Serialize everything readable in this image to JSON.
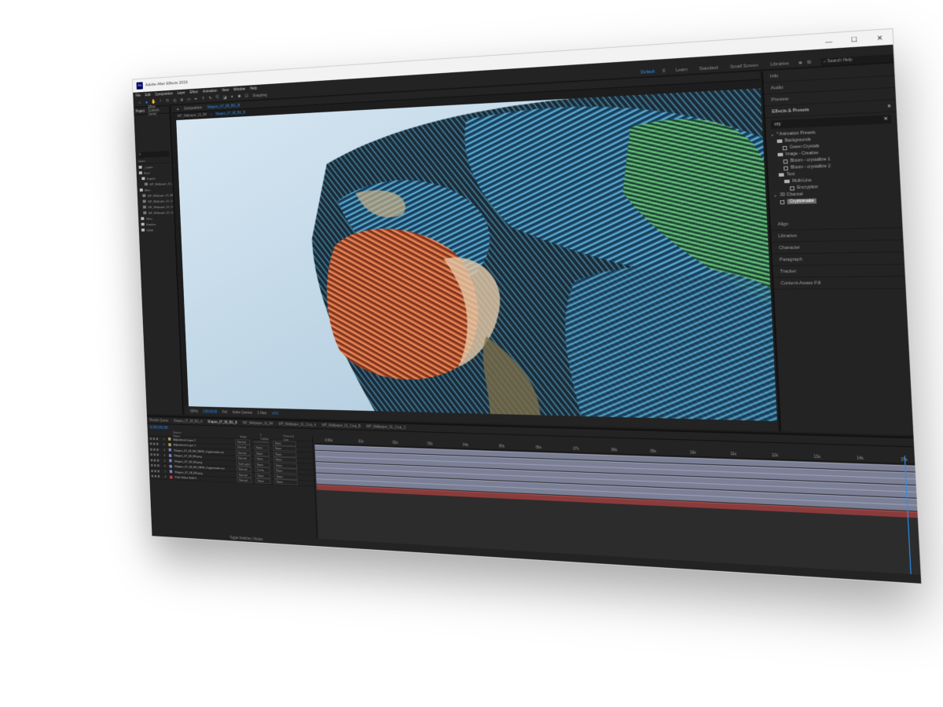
{
  "app": {
    "title": "Adobe After Effects 2019",
    "logo_text": "Ae",
    "window_controls": [
      "—",
      "☐",
      "✕"
    ]
  },
  "menu": [
    "File",
    "Edit",
    "Composition",
    "Layer",
    "Effect",
    "Animation",
    "View",
    "Window",
    "Help"
  ],
  "toolbar": {
    "snapping_label": "Snapping",
    "workspaces": [
      "Default",
      "Learn",
      "Standard",
      "Small Screen",
      "Libraries"
    ],
    "active_workspace": "Default",
    "more_label": "»",
    "search_help_placeholder": "Search Help"
  },
  "project_panel": {
    "tabs": [
      "Project",
      "Effect Controls (none)"
    ],
    "search_placeholder": "ρ.",
    "column_name": "Name",
    "items": [
      {
        "name": "_Layers",
        "type": "folder",
        "indent": 1
      },
      {
        "name": "Final",
        "type": "folder",
        "indent": 1
      },
      {
        "name": "Exports",
        "type": "folder",
        "indent": 2
      },
      {
        "name": "WP_Wallpaper_01_04.png",
        "type": "file",
        "indent": 3
      },
      {
        "name": "Main",
        "type": "folder",
        "indent": 1
      },
      {
        "name": "WP_Wallpaper_01_B4",
        "type": "comp",
        "indent": 2
      },
      {
        "name": "WP_Wallpaper_01_Crop_A",
        "type": "comp",
        "indent": 2
      },
      {
        "name": "WP_Wallpaper_01_Crop_B",
        "type": "comp",
        "indent": 2
      },
      {
        "name": "WP_Wallpaper_01_Crop_C",
        "type": "comp",
        "indent": 2
      },
      {
        "name": "Other",
        "type": "folder",
        "indent": 1
      },
      {
        "name": "Renders",
        "type": "folder",
        "indent": 1
      },
      {
        "name": "Solids",
        "type": "folder",
        "indent": 1
      }
    ]
  },
  "composition": {
    "tabs": [
      "Composition",
      "Shapes_07_08_BG_B"
    ],
    "breadcrumbs": [
      "WP_Wallpaper_01_B4",
      "Shapes_07_08_BG_B"
    ],
    "viewer_bar": [
      "(50%)",
      "0;00;00;00",
      "Full",
      "Active Camera",
      "1 View",
      "+0.0"
    ],
    "zoom_label": "(50%)"
  },
  "effects_panel": {
    "headers": [
      "Info",
      "Audio",
      "Preview",
      "Effects & Presets"
    ],
    "search_value": "cry",
    "menu_icon": "≡",
    "tree": [
      {
        "label": "* Animation Presets",
        "level": 0,
        "kind": "twirl"
      },
      {
        "label": "Backgrounds",
        "level": 1,
        "kind": "folder"
      },
      {
        "label": "Green Crystals",
        "level": 2,
        "kind": "effect"
      },
      {
        "label": "Image - Creative",
        "level": 1,
        "kind": "folder"
      },
      {
        "label": "Bloom - crystallize 1",
        "level": 2,
        "kind": "effect"
      },
      {
        "label": "Bloom - crystallize 2",
        "level": 2,
        "kind": "effect"
      },
      {
        "label": "Text",
        "level": 1,
        "kind": "folder"
      },
      {
        "label": "Multi-Line",
        "level": 2,
        "kind": "folder"
      },
      {
        "label": "Encryption",
        "level": 3,
        "kind": "effect"
      },
      {
        "label": "3D Channel",
        "level": 0,
        "kind": "twirl"
      },
      {
        "label": "Cryptomatte",
        "level": 1,
        "kind": "effect",
        "selected": true
      }
    ],
    "other_panels": [
      "Align",
      "Libraries",
      "Character",
      "Paragraph",
      "Tracker",
      "Content-Aware Fill"
    ]
  },
  "timeline": {
    "tabs": [
      "Render Queue",
      "Shapes_07_08_BG_A",
      "Shapes_07_08_BG_B",
      "WP_Wallpaper_01_B4",
      "WP_Wallpaper_01_Crop_A",
      "WP_Wallpaper_01_Crop_B",
      "WP_Wallpaper_01_Crop_C"
    ],
    "current_tab": "Shapes_07_08_BG_B",
    "timecode": "0;00;00;00",
    "columns": [
      "Source Name",
      "Mode",
      "T TrkMat",
      "Parent & Link"
    ],
    "layers": [
      {
        "num": "1",
        "name": "Adjustment Layer 2",
        "mode": "Normal",
        "trk": "",
        "parent": "None",
        "color": "#b0a060"
      },
      {
        "num": "2",
        "name": "Adjustment Layer 1",
        "mode": "Normal",
        "trk": "None",
        "parent": "None",
        "color": "#b0a060"
      },
      {
        "num": "3",
        "name": "Shapes_07_08_BG_NEW_Cryptomatte.exr",
        "mode": "Normal",
        "trk": "None",
        "parent": "None",
        "color": "#7a80c0"
      },
      {
        "num": "4",
        "name": "Shapes_07_08_BG.png",
        "mode": "Normal",
        "trk": "None",
        "parent": "None",
        "color": "#7a80c0"
      },
      {
        "num": "5",
        "name": "Shapes_07_08_BG.png",
        "mode": "Soft Light",
        "trk": "None",
        "parent": "None",
        "color": "#7a80c0"
      },
      {
        "num": "6",
        "name": "Shapes_07_08_BG_NEW_Cryptomatte.exr",
        "mode": "Normal",
        "trk": "Luma",
        "parent": "None",
        "color": "#7a80c0"
      },
      {
        "num": "7",
        "name": "Shapes_07_08_BG.png",
        "mode": "Normal",
        "trk": "None",
        "parent": "None",
        "color": "#7a80c0"
      },
      {
        "num": "8",
        "name": "Pale Yellow Solid 1",
        "mode": "Normal",
        "trk": "None",
        "parent": "None",
        "color": "#c04040"
      }
    ],
    "ruler": [
      "0:00s",
      "01s",
      "02s",
      "03s",
      "04s",
      "05s",
      "06s",
      "07s",
      "08s",
      "09s",
      "10s",
      "11s",
      "12s",
      "13s",
      "14s",
      "15s"
    ],
    "footer": "Toggle Switches / Modes",
    "bars": [
      "grey",
      "grey",
      "grey",
      "grey",
      "grey",
      "grey",
      "grey",
      "red"
    ]
  },
  "colors": {
    "accent": "#2d8ceb",
    "panel": "#232323",
    "background": "#1d1d1d",
    "layer_bar": "#7b7f95",
    "solid_bar": "#8b3b3b"
  }
}
